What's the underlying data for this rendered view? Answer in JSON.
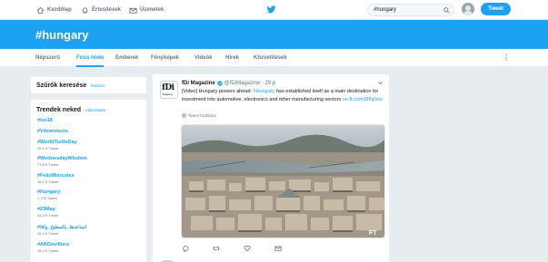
{
  "nav": {
    "home": "Kezdőlap",
    "notifications": "Értesítések",
    "messages": "Üzenetek",
    "search_value": "#hungary",
    "tweet_button": "Tweet"
  },
  "banner": {
    "title": "#hungary"
  },
  "tabs": [
    "Népszerű",
    "Friss hírek",
    "Emberek",
    "Fényképek",
    "Videók",
    "Hírek",
    "Közvetítések"
  ],
  "sidebar": {
    "filters_title": "Szűrők keresése",
    "filters_link": "· Mutasd",
    "trends_title": "Trendek neked",
    "trends_link": "· Változtatás",
    "trends": [
      {
        "name": "#ice18",
        "count": ""
      },
      {
        "name": "#V4connects",
        "count": ""
      },
      {
        "name": "#WorldTurtleDay",
        "count": "25,1 E Tweet"
      },
      {
        "name": "#WednesdayWisdom",
        "count": "77,6 E Tweet"
      },
      {
        "name": "#FelizMiércoles",
        "count": "18,1 E Tweet"
      },
      {
        "name": "#Hungary",
        "count": "1 378 Tweet"
      },
      {
        "name": "#23May",
        "count": "34,4 E Tweet"
      },
      {
        "name": "#اساعدها_بالمطبخ_واقا",
        "count": "25,4 E Tweet"
      },
      {
        "name": "#ABDevilliers",
        "count": "18,1 E Tweet"
      }
    ]
  },
  "tweet": {
    "author": "fDi Magazine",
    "handle": "@fDiMagazine · 29 p",
    "text_prefix": "[Video] Hungary powers ahead: ",
    "hashtag": "#Hungary",
    "text_suffix": " has established itself as a main destination for investment into automotive, electronics and other manufacturing sectors ",
    "link": "on.ft.com/2IFgVss",
    "translate": "Tweet fordítása",
    "logo_text": "fDi",
    "logo_sub": "Magazine",
    "media_watermark": "FT"
  },
  "colors": {
    "accent": "#1da1f2",
    "background": "#e6ecf0"
  }
}
